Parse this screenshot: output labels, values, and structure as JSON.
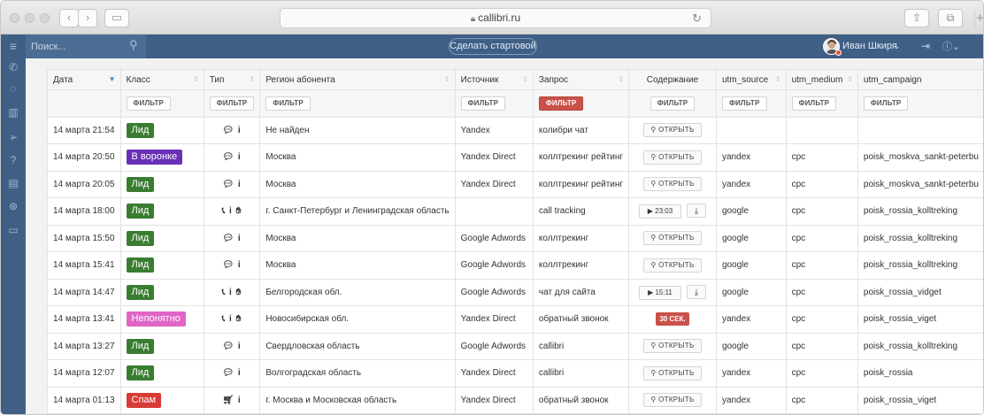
{
  "browser": {
    "url": "callibri.ru",
    "back_icon": "chevron-left-icon",
    "forward_icon": "chevron-right-icon",
    "sidebar_icon": "sidebar-toggle-icon",
    "reload_icon": "reload-icon",
    "share_icon": "share-icon",
    "tabs_icon": "tabs-icon",
    "new_tab_label": "+"
  },
  "header": {
    "search_placeholder": "Поиск...",
    "start_page_label": "Сделать стартовой",
    "user_name": "Иван Шкиря",
    "user_caret": "⌄",
    "help_label": "?"
  },
  "sidebar": {
    "items": [
      "menu-icon",
      "phone-icon",
      "chat-icon",
      "stats-icon",
      "send-icon",
      "help-icon",
      "book-icon",
      "support-icon",
      "card-icon"
    ]
  },
  "table": {
    "columns": [
      "Дата",
      "Класс",
      "Тип",
      "Регион абонента",
      "Источник",
      "Запрос",
      "Содержание",
      "utm_source",
      "utm_medium",
      "utm_campaign"
    ],
    "filter_label": "ФИЛЬТР",
    "open_label": "ОТКРЫТЬ",
    "rows": [
      {
        "date": "14 марта 21:54",
        "class": "Лид",
        "class_color": "green",
        "type": "chat",
        "region": "Не найден",
        "source": "Yandex",
        "query": "колибри чат",
        "content": "open",
        "utm_source": "",
        "utm_medium": "",
        "utm_campaign": ""
      },
      {
        "date": "14 марта 20:50",
        "class": "В воронке",
        "class_color": "purple",
        "type": "chat",
        "region": "Москва",
        "source": "Yandex Direct",
        "query": "коллтрекинг рейтинг",
        "content": "open",
        "utm_source": "yandex",
        "utm_medium": "cpc",
        "utm_campaign": "poisk_moskva_sankt-peterbu"
      },
      {
        "date": "14 марта 20:05",
        "class": "Лид",
        "class_color": "green",
        "type": "chat",
        "region": "Москва",
        "source": "Yandex Direct",
        "query": "коллтрекинг рейтинг",
        "content": "open",
        "utm_source": "yandex",
        "utm_medium": "cpc",
        "utm_campaign": "poisk_moskva_sankt-peterbu"
      },
      {
        "date": "14 марта 18:00",
        "class": "Лид",
        "class_color": "green",
        "type": "call",
        "region": "г. Санкт-Петербург и Ленинградская область",
        "source": "",
        "query": "call tracking",
        "content": "play",
        "duration": "23:03",
        "utm_source": "google",
        "utm_medium": "cpc",
        "utm_campaign": "poisk_rossia_kolltreking"
      },
      {
        "date": "14 марта 15:50",
        "class": "Лид",
        "class_color": "green",
        "type": "chat",
        "region": "Москва",
        "source": "Google Adwords",
        "query": "коллтрекинг",
        "content": "open",
        "utm_source": "google",
        "utm_medium": "cpc",
        "utm_campaign": "poisk_rossia_kolltreking"
      },
      {
        "date": "14 марта 15:41",
        "class": "Лид",
        "class_color": "green",
        "type": "chat",
        "region": "Москва",
        "source": "Google Adwords",
        "query": "коллтрекинг",
        "content": "open",
        "utm_source": "google",
        "utm_medium": "cpc",
        "utm_campaign": "poisk_rossia_kolltreking"
      },
      {
        "date": "14 марта 14:47",
        "class": "Лид",
        "class_color": "green",
        "type": "call",
        "region": "Белгородская обл.",
        "source": "Google Adwords",
        "query": "чат для сайта",
        "content": "play",
        "duration": "15:11",
        "utm_source": "google",
        "utm_medium": "cpc",
        "utm_campaign": "poisk_rossia_vidget"
      },
      {
        "date": "14 марта 13:41",
        "class": "Непонятно",
        "class_color": "pink",
        "type": "call",
        "region": "Новосибирская обл.",
        "source": "Yandex Direct",
        "query": "обратный звонок",
        "content": "badge",
        "badge": "30 СЕК.",
        "utm_source": "yandex",
        "utm_medium": "cpc",
        "utm_campaign": "poisk_rossia_viget"
      },
      {
        "date": "14 марта 13:27",
        "class": "Лид",
        "class_color": "green",
        "type": "chat",
        "region": "Свердловская область",
        "source": "Google Adwords",
        "query": "callibri",
        "content": "open",
        "utm_source": "google",
        "utm_medium": "cpc",
        "utm_campaign": "poisk_rossia_kolltreking"
      },
      {
        "date": "14 марта 12:07",
        "class": "Лид",
        "class_color": "green",
        "type": "chat",
        "region": "Волгоградская область",
        "source": "Yandex Direct",
        "query": "callibri",
        "content": "open",
        "utm_source": "yandex",
        "utm_medium": "cpc",
        "utm_campaign": "poisk_rossia"
      },
      {
        "date": "14 марта 01:13",
        "class": "Спам",
        "class_color": "red",
        "type": "form",
        "region": "г. Москва и Московская область",
        "source": "Yandex Direct",
        "query": "обратный звонок",
        "content": "open",
        "utm_source": "yandex",
        "utm_medium": "cpc",
        "utm_campaign": "poisk_rossia_viget"
      }
    ]
  }
}
